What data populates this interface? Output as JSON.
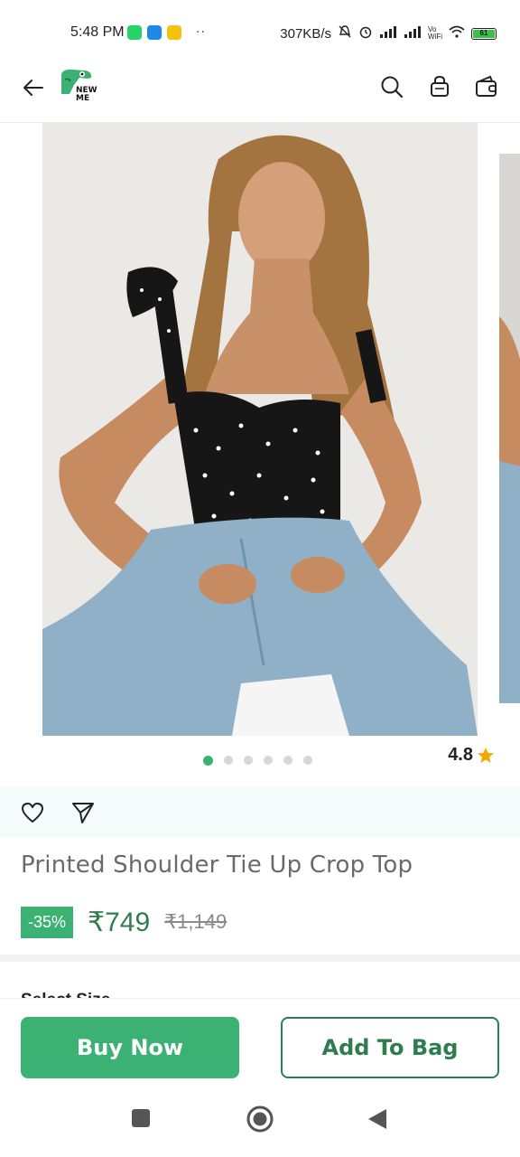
{
  "status_bar": {
    "time": "5:48 PM",
    "net_speed": "307KB/s",
    "wifi_label": "Vo WiFi",
    "battery": "61"
  },
  "header": {
    "logo_text_line1": "NEW",
    "logo_text_line2": "ME",
    "icons": [
      "back-arrow-icon",
      "search-icon",
      "bag-icon",
      "wallet-icon"
    ]
  },
  "gallery": {
    "image_count": 6,
    "active_index": 0
  },
  "product": {
    "rating": "4.8",
    "title": "Printed Shoulder Tie Up Crop Top",
    "discount": "-35%",
    "price": "₹749",
    "mrp": "₹1,149"
  },
  "section": {
    "select_size_label": "Select Size"
  },
  "actions": {
    "buy_now": "Buy Now",
    "add_to_bag": "Add To Bag"
  },
  "colors": {
    "brand_green": "#3bb273",
    "price_green": "#2f7d4e",
    "star": "#f2a900"
  }
}
